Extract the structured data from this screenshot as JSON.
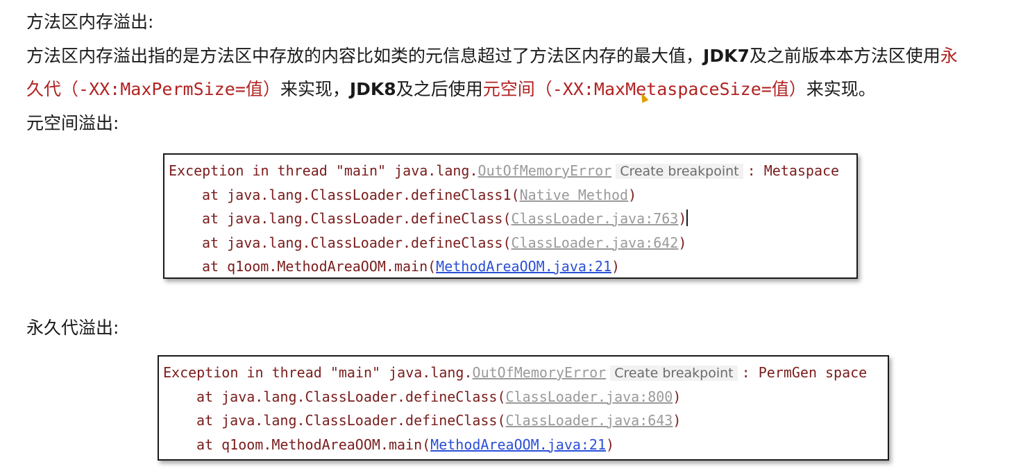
{
  "heading_method_area": "方法区内存溢出:",
  "paragraph": {
    "p1": "方法区内存溢出指的是方法区中存放的内容比如类的元信息超过了方法区内存的最大值，",
    "jdk7": "JDK7",
    "p2": "及之前版本本方法区使用",
    "yong": "永",
    "jiu_dai": "久代",
    "perm_param": "（-XX:MaxPermSize=值）",
    "p3": "来实现，",
    "jdk8": "JDK8",
    "p4": "及之后使用",
    "metaspace_term": "元空间",
    "meta_param": "（-XX:MaxMetaspaceSize=值）",
    "p5": "来实现。"
  },
  "heading_metaspace": "元空间溢出:",
  "heading_permgen": "永久代溢出:",
  "console_metaspace": {
    "line1_prefix": "Exception in thread \"main\" java.lang.",
    "line1_link": "OutOfMemoryError",
    "line1_tip": "Create breakpoint",
    "line1_suffix": ": Metaspace",
    "frames": [
      {
        "text": "at java.lang.ClassLoader.defineClass1(",
        "link": "Native Method",
        "close": ")"
      },
      {
        "text": "at java.lang.ClassLoader.defineClass(",
        "link": "ClassLoader.java:763",
        "close": ")"
      },
      {
        "text": "at java.lang.ClassLoader.defineClass(",
        "link": "ClassLoader.java:642",
        "close": ")"
      },
      {
        "text": "at q1oom.MethodAreaOOM.main(",
        "link": "MethodAreaOOM.java:21",
        "close": ")"
      }
    ]
  },
  "console_permgen": {
    "line1_prefix": "Exception in thread \"main\" java.lang.",
    "line1_link": "OutOfMemoryError",
    "line1_tip": "Create breakpoint",
    "line1_suffix": ": PermGen space",
    "frames": [
      {
        "text": "at java.lang.ClassLoader.defineClass(",
        "link": "ClassLoader.java:800",
        "close": ")"
      },
      {
        "text": "at java.lang.ClassLoader.defineClass(",
        "link": "ClassLoader.java:643",
        "close": ")"
      },
      {
        "text": "at q1oom.MethodAreaOOM.main(",
        "link": "MethodAreaOOM.java:21",
        "close": ")"
      }
    ]
  },
  "colors": {
    "text": "#1a1a1a",
    "highlight_red": "#b22222",
    "console_text": "#7a1c1c",
    "grey_link": "#9a9a9a",
    "blue_link": "#2a4fd6"
  }
}
